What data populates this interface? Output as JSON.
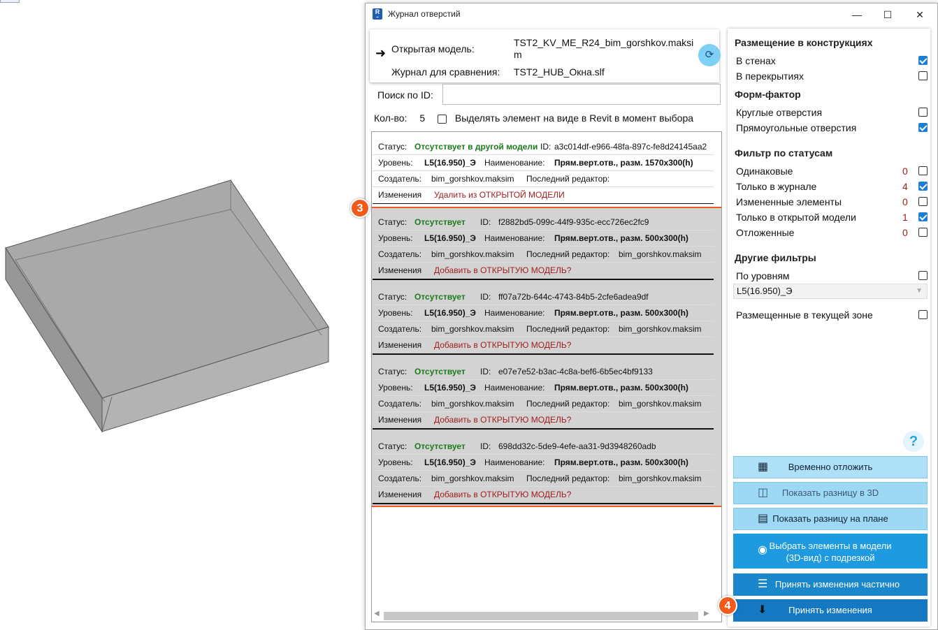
{
  "window": {
    "title": "Журнал отверстий",
    "minimize": "—",
    "maximize": "☐",
    "close": "✕"
  },
  "header": {
    "open_model_label": "Открытая модель:",
    "open_model_value": "TST2_KV_ME_R24_bim_gorshkov.maksim",
    "compare_label": "Журнал для сравнения:",
    "compare_value": "TST2_HUB_Окна.slf"
  },
  "search": {
    "label": "Поиск по ID:",
    "value": ""
  },
  "count": {
    "label": "Кол-во:",
    "value": "5",
    "highlight_label": "Выделять элемент на виде в Revit в момент выбора"
  },
  "entries": [
    {
      "status_label": "Статус:",
      "status": "Отсутствует в другой модели",
      "id_label": "ID:",
      "id": "a3c014df-e966-48fa-897c-fe8d24145aa2",
      "level_label": "Уровень:",
      "level": "L5(16.950)_Э",
      "name_label": "Наименование:",
      "name": "Прям.верт.отв., разм. 1570x300(h)",
      "creator_label": "Создатель:",
      "creator": "bim_gorshkov.maksim",
      "editor_label": "Последний редактор:",
      "editor": "",
      "changes_label": "Изменения",
      "changes": "Удалить из ОТКРЫТОЙ МОДЕЛИ"
    },
    {
      "status_label": "Статус:",
      "status": "Отсутствует",
      "id_label": "ID:",
      "id": "f2882bd5-099c-44f9-935c-ecc726ec2fc9",
      "level_label": "Уровень:",
      "level": "L5(16.950)_Э",
      "name_label": "Наименование:",
      "name": "Прям.верт.отв., разм. 500x300(h)",
      "creator_label": "Создатель:",
      "creator": "bim_gorshkov.maksim",
      "editor_label": "Последний редактор:",
      "editor": "bim_gorshkov.maksim",
      "changes_label": "Изменения",
      "changes": "Добавить в ОТКРЫТУЮ МОДЕЛЬ?"
    },
    {
      "status_label": "Статус:",
      "status": "Отсутствует",
      "id_label": "ID:",
      "id": "ff07a72b-644c-4743-84b5-2cfe6adea9df",
      "level_label": "Уровень:",
      "level": "L5(16.950)_Э",
      "name_label": "Наименование:",
      "name": "Прям.верт.отв., разм. 500x300(h)",
      "creator_label": "Создатель:",
      "creator": "bim_gorshkov.maksim",
      "editor_label": "Последний редактор:",
      "editor": "bim_gorshkov.maksim",
      "changes_label": "Изменения",
      "changes": "Добавить в ОТКРЫТУЮ МОДЕЛЬ?"
    },
    {
      "status_label": "Статус:",
      "status": "Отсутствует",
      "id_label": "ID:",
      "id": "e07e7e52-b3ac-4c8a-bef6-6b5ec4bf9133",
      "level_label": "Уровень:",
      "level": "L5(16.950)_Э",
      "name_label": "Наименование:",
      "name": "Прям.верт.отв., разм. 500x300(h)",
      "creator_label": "Создатель:",
      "creator": "bim_gorshkov.maksim",
      "editor_label": "Последний редактор:",
      "editor": "bim_gorshkov.maksim",
      "changes_label": "Изменения",
      "changes": "Добавить в ОТКРЫТУЮ МОДЕЛЬ?"
    },
    {
      "status_label": "Статус:",
      "status": "Отсутствует",
      "id_label": "ID:",
      "id": "698dd32c-5de9-4efe-aa31-9d3948260adb",
      "level_label": "Уровень:",
      "level": "L5(16.950)_Э",
      "name_label": "Наименование:",
      "name": "Прям.верт.отв., разм. 500x300(h)",
      "creator_label": "Создатель:",
      "creator": "bim_gorshkov.maksim",
      "editor_label": "Последний редактор:",
      "editor": "bim_gorshkov.maksim",
      "changes_label": "Изменения",
      "changes": "Добавить в ОТКРЫТУЮ МОДЕЛЬ?"
    }
  ],
  "badges": {
    "selection": "3",
    "accept": "4"
  },
  "filters": {
    "placement_title": "Размещение в конструкциях",
    "in_walls": "В стенах",
    "in_floors": "В перекрытиях",
    "form_title": "Форм-фактор",
    "round": "Круглые отверстия",
    "rect": "Прямоугольные отверстия",
    "status_title": "Фильтр по статусам",
    "statuses": [
      {
        "label": "Одинаковые",
        "count": "0"
      },
      {
        "label": "Только в журнале",
        "count": "4"
      },
      {
        "label": "Измененные элементы",
        "count": "0"
      },
      {
        "label": "Только в открытой модели",
        "count": "1"
      },
      {
        "label": "Отложенные",
        "count": "0"
      }
    ],
    "other_title": "Другие фильтры",
    "by_levels": "По уровням",
    "level_value": "L5(16.950)_Э",
    "in_zone": "Размещенные в текущей зоне"
  },
  "actions": {
    "postpone": "Временно отложить",
    "diff_3d": "Показать разницу в 3D",
    "diff_plan": "Показать разницу на плане",
    "select_3d_line1": "Выбрать элементы в модели",
    "select_3d_line2": "(3D-вид) с подрезкой",
    "accept_partial": "Принять изменения частично",
    "accept": "Принять изменения",
    "help": "?"
  },
  "colors": {
    "accent": "#f05a1a",
    "button_light": "#aee0f7",
    "button_dark": "#1e9be0",
    "button_darker": "#1479c2"
  }
}
